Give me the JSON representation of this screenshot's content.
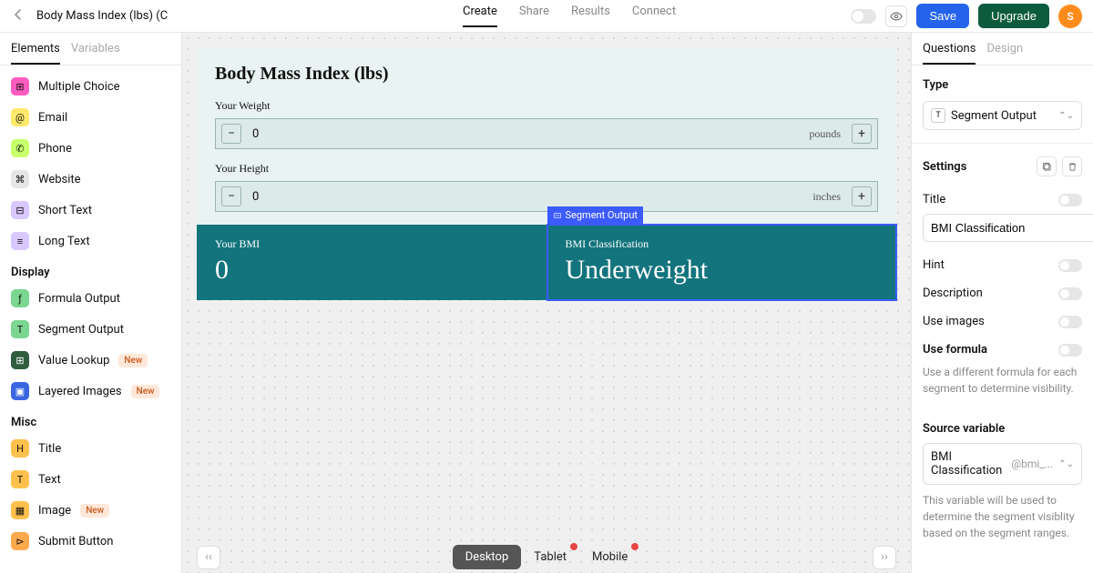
{
  "header": {
    "page_title": "Body Mass Index (lbs) (C",
    "tabs": [
      "Create",
      "Share",
      "Results",
      "Connect"
    ],
    "active_tab": 0,
    "save": "Save",
    "upgrade": "Upgrade",
    "avatar_initial": "S"
  },
  "left": {
    "tabs": [
      "Elements",
      "Variables"
    ],
    "active_tab": 0,
    "items_input": [
      {
        "label": "Multiple Choice",
        "bg": "#ff5cbf",
        "glyph": "⊞"
      },
      {
        "label": "Email",
        "bg": "#ffe96b",
        "glyph": "@"
      },
      {
        "label": "Phone",
        "bg": "#c6ff6b",
        "glyph": "✆"
      },
      {
        "label": "Website",
        "bg": "#e6e6e6",
        "glyph": "⌘"
      },
      {
        "label": "Short Text",
        "bg": "#d9c7ff",
        "glyph": "⊟"
      },
      {
        "label": "Long Text",
        "bg": "#d9c7ff",
        "glyph": "≡"
      }
    ],
    "cat_display": "Display",
    "items_display": [
      {
        "label": "Formula Output",
        "bg": "#7bd68f",
        "glyph": "ƒ",
        "new": false
      },
      {
        "label": "Segment Output",
        "bg": "#7bd68f",
        "glyph": "T",
        "new": false
      },
      {
        "label": "Value Lookup",
        "bg": "#2f5d3f",
        "glyph": "⊞",
        "new": true,
        "fg": "#fff"
      },
      {
        "label": "Layered Images",
        "bg": "#3a66e0",
        "glyph": "▣",
        "new": true,
        "fg": "#fff"
      }
    ],
    "cat_misc": "Misc",
    "items_misc": [
      {
        "label": "Title",
        "bg": "#ffc14d",
        "glyph": "H"
      },
      {
        "label": "Text",
        "bg": "#ffc14d",
        "glyph": "T"
      },
      {
        "label": "Image",
        "bg": "#ffc14d",
        "glyph": "▦",
        "new": true
      },
      {
        "label": "Submit Button",
        "bg": "#ffa94d",
        "glyph": "⊳"
      }
    ],
    "new_badge": "New"
  },
  "canvas": {
    "form_title": "Body Mass Index (lbs)",
    "weight_label": "Your Weight",
    "weight_value": "0",
    "weight_unit": "pounds",
    "height_label": "Your Height",
    "height_value": "0",
    "height_unit": "inches",
    "bmi_label": "Your BMI",
    "bmi_value": "0",
    "class_label": "BMI Classification",
    "class_value": "Underweight",
    "sel_tag": "Segment Output",
    "viewports": [
      "Desktop",
      "Tablet",
      "Mobile"
    ],
    "active_vp": 0
  },
  "right": {
    "tabs": [
      "Questions",
      "Design"
    ],
    "active_tab": 0,
    "type_label": "Type",
    "type_value": "Segment Output",
    "settings_label": "Settings",
    "title_label": "Title",
    "title_value": "BMI Classification",
    "hint_label": "Hint",
    "desc_label": "Description",
    "images_label": "Use images",
    "formula_label": "Use formula",
    "formula_help": "Use a different formula for each segment to determine visibility.",
    "source_label": "Source variable",
    "source_value": "BMI Classification",
    "source_var": "@bmi_...",
    "source_help": "This variable will be used to determine the segment visiblity based on the segment ranges."
  }
}
